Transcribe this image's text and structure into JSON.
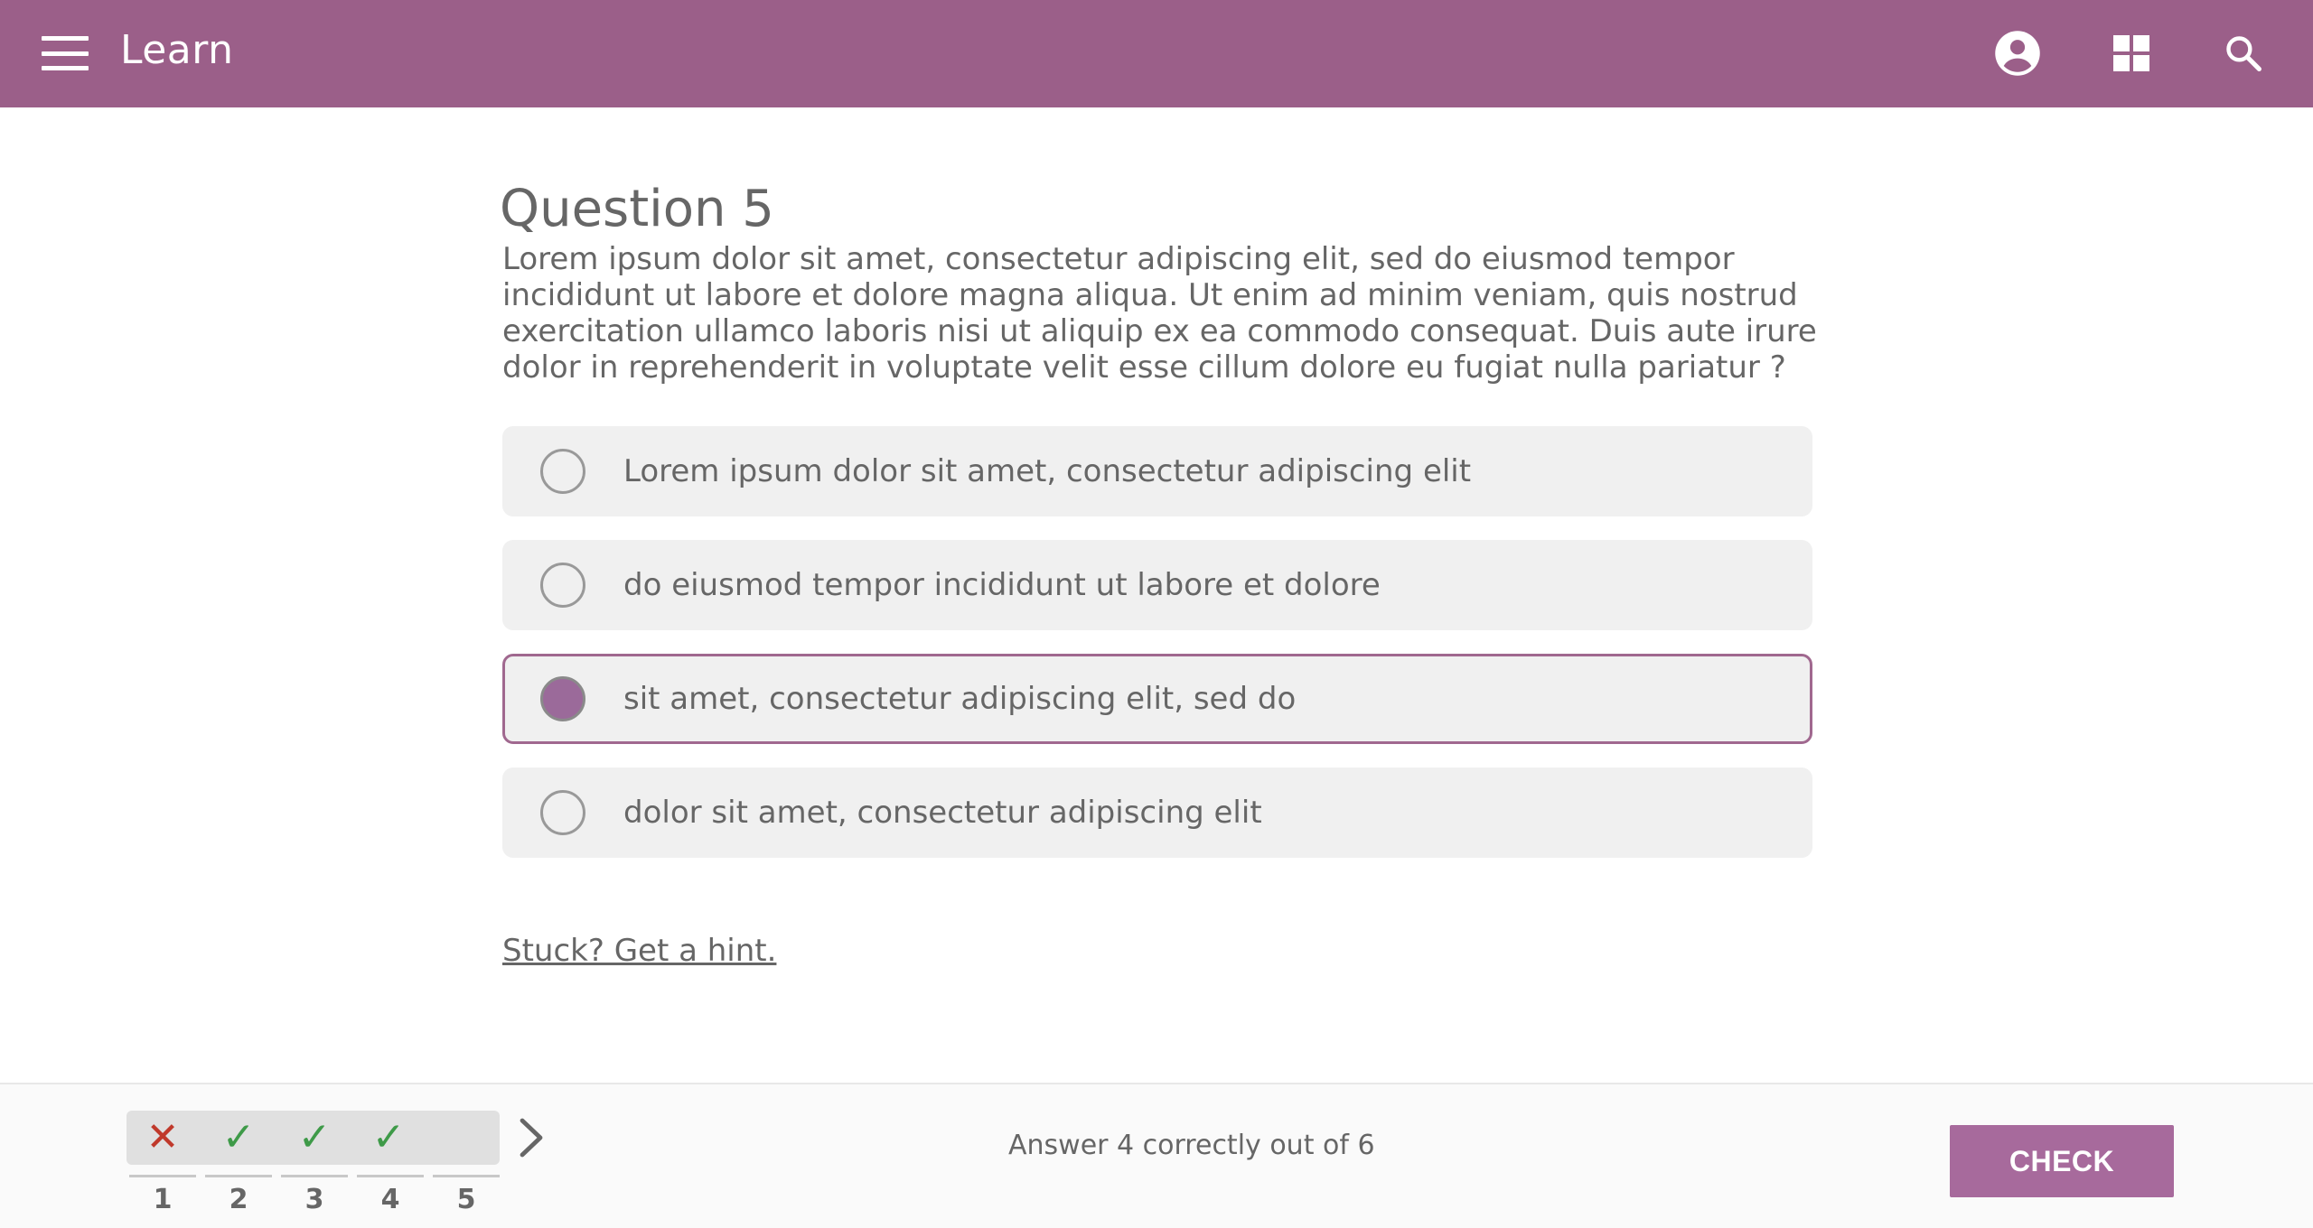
{
  "appbar": {
    "title": "Learn",
    "icons": [
      "menu-icon",
      "account-icon",
      "apps-grid-icon",
      "search-icon"
    ],
    "color": "#9b5f89"
  },
  "question": {
    "title": "Question 5",
    "text": "Lorem ipsum dolor sit amet, consectetur adipiscing elit, sed do eiusmod tempor incididunt ut labore et dolore magna aliqua. Ut enim ad minim veniam, quis nostrud exercitation ullamco laboris nisi ut aliquip ex ea commodo consequat. Duis aute irure dolor in reprehenderit in voluptate velit esse cillum dolore eu fugiat nulla pariatur ?",
    "options": [
      {
        "label": "Lorem ipsum dolor sit amet, consectetur adipiscing elit",
        "selected": false
      },
      {
        "label": "do eiusmod tempor incididunt ut labore et dolore",
        "selected": false
      },
      {
        "label": "sit amet, consectetur adipiscing elit, sed do",
        "selected": true
      },
      {
        "label": "dolor sit amet, consectetur adipiscing elit",
        "selected": false
      }
    ],
    "hint_link": "Stuck? Get a hint."
  },
  "footer": {
    "attempts": [
      {
        "number": "1",
        "result": "wrong",
        "mark": "✕"
      },
      {
        "number": "2",
        "result": "correct",
        "mark": "✓"
      },
      {
        "number": "3",
        "result": "correct",
        "mark": "✓"
      },
      {
        "number": "4",
        "result": "correct",
        "mark": "✓"
      },
      {
        "number": "5",
        "result": "pending",
        "mark": ""
      }
    ],
    "status_text": "Answer 4 correctly out of 6",
    "check_label": "CHECK",
    "check_color": "#a76a9c"
  }
}
